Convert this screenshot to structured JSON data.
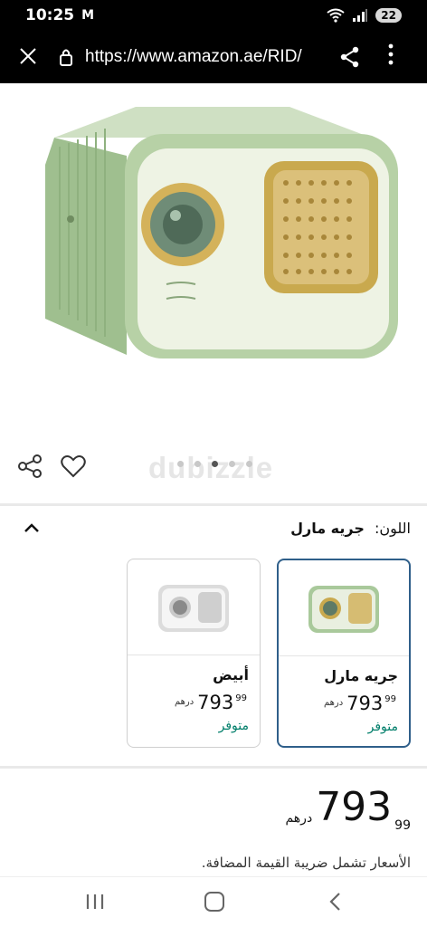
{
  "status": {
    "time": "10:25",
    "mail_glyph": "M",
    "battery": "22"
  },
  "browser": {
    "url": "https://www.amazon.ae/RID/"
  },
  "gallery": {
    "watermark": "dubizzle",
    "dot_count": 5,
    "active_dot": 3
  },
  "color_selector": {
    "label": "اللون:",
    "selected_value": "جريه مارل",
    "options": [
      {
        "name": "جريه مارل",
        "price_int": "793",
        "price_frac": "99",
        "currency": "درهم",
        "stock": "متوفر",
        "selected": true,
        "accent": "#a9c99b"
      },
      {
        "name": "أبيض",
        "price_int": "793",
        "price_frac": "99",
        "currency": "درهم",
        "stock": "متوفر",
        "selected": false,
        "accent": "#e8e8e8"
      }
    ]
  },
  "price": {
    "int": "793",
    "frac": "99",
    "currency": "درهم"
  },
  "vat_note": "الأسعار تشمل ضريبة القيمة المضافة.",
  "colors": {
    "accent": "#2f5f8a",
    "in_stock": "#007e6a"
  }
}
